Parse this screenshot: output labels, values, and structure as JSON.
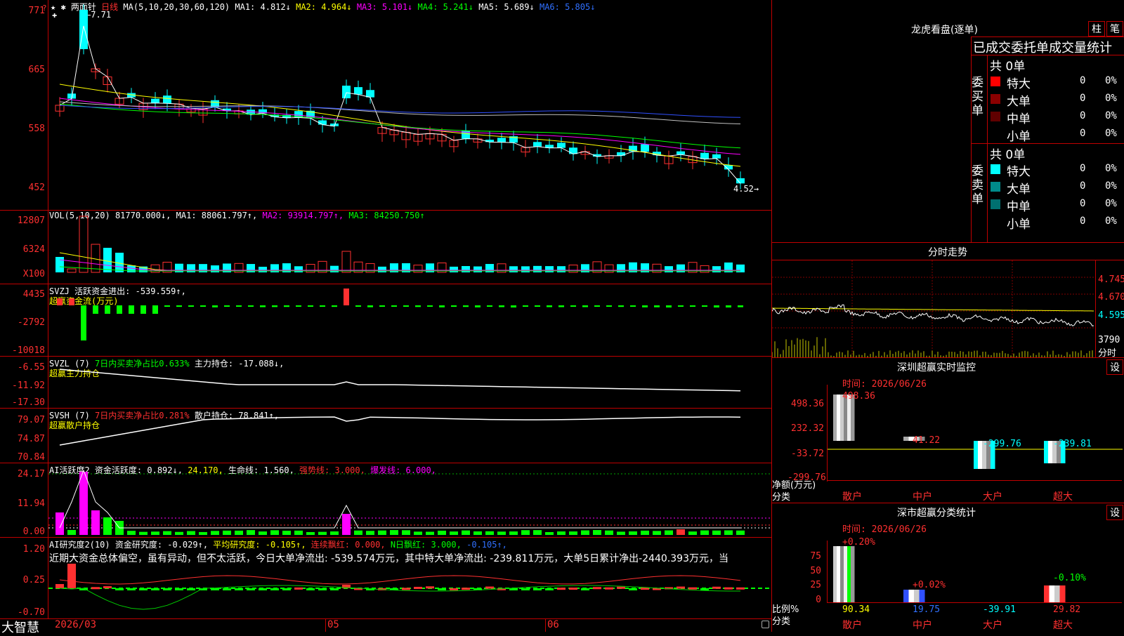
{
  "header": {
    "indicator_marks": "★ ✱",
    "stock_name": "两面针",
    "period": "日线",
    "ma_params": "MA(5,10,20,30,60,120)",
    "ma1": "MA1: 4.812↓",
    "ma2": "MA2: 4.964↓",
    "ma3": "MA3: 5.101↓",
    "ma4": "MA4: 5.241↓",
    "ma5": "MA5: 5.689↓",
    "ma6": "MA6: 5.805↓",
    "high_marker": "7.71",
    "low_marker": "4.52"
  },
  "price_axis": [
    "771",
    "665",
    "558",
    "452"
  ],
  "vol": {
    "title": "VOL(5,10,20)",
    "value": "81770.000↓,",
    "ma1": "MA1: 88061.797↑,",
    "ma2": "MA2: 93914.797↑,",
    "ma3": "MA3: 84250.750↑",
    "axis": [
      "12807",
      "6324",
      "X100"
    ]
  },
  "svzj": {
    "title": "SVZJ",
    "text": "活跃资金进出: -539.559↑,",
    "subtitle": "超赢资金流(万元)",
    "axis": [
      "4435",
      "-2792",
      "-10018"
    ]
  },
  "svzl": {
    "title": "SVZL (7)",
    "ratio": "7日内买卖净占比0.633%",
    "holding": "主力持仓: -17.088↓,",
    "subtitle": "超赢主力持仓",
    "axis": [
      "-6.55",
      "-11.92",
      "-17.30"
    ]
  },
  "svsh": {
    "title": "SVSH (7)",
    "ratio": "7日内买卖净占比0.281%",
    "holding": "散户持仓: 78.841↑,",
    "subtitle": "超赢散户持仓",
    "axis": [
      "79.07",
      "74.87",
      "70.84"
    ]
  },
  "ai1": {
    "title": "AI活跃度2",
    "fund": "资金活跃度: 0.892↓,",
    "v2": "24.170,",
    "life": "生命线: 1.560,",
    "strong": "强势线: 3.000,",
    "burst": "爆发线: 6.000,",
    "axis": [
      "24.17",
      "11.94",
      "0.00"
    ]
  },
  "ai2": {
    "title": "AI研究度2(10)",
    "fund": "资金研究度: -0.029↑,",
    "avg": "平均研究度: -0.105↑,",
    "cont": "连续飘红: 0.000,",
    "nday": "N日飘红: 3.000,",
    "last": "-0.105↑,",
    "comment": "近期大资金总体偏空，虽有异动，但不太活跃，今日大单净流出: -539.574万元，其中特大单净流出: -239.811万元，大单5日累计净出-2440.393万元，当",
    "axis": [
      "1.20",
      "0.25",
      "-0.70"
    ]
  },
  "bottom": {
    "logo": "大智慧",
    "dates": [
      "2026/03",
      "05",
      "06"
    ]
  },
  "right": {
    "lhb_title": "龙虎看盘(逐单)",
    "btn_zhu": "柱",
    "btn_bi": "笔",
    "stat_title": "已成交委托单成交量统计",
    "buy_label": "委买单",
    "sell_label": "委卖单",
    "buy_total": "共 0单",
    "sell_total": "共 0单",
    "buy_rows": [
      {
        "name": "特大",
        "count": "0",
        "pct": "0%",
        "color": "#ff0000"
      },
      {
        "name": "大单",
        "count": "0",
        "pct": "0%",
        "color": "#8b0000"
      },
      {
        "name": "中单",
        "count": "0",
        "pct": "0%",
        "color": "#600000"
      },
      {
        "name": "小单",
        "count": "0",
        "pct": "0%",
        "color": ""
      }
    ],
    "sell_rows": [
      {
        "name": "特大",
        "count": "0",
        "pct": "0%",
        "color": "#00ffff"
      },
      {
        "name": "大单",
        "count": "0",
        "pct": "0%",
        "color": "#008b8b"
      },
      {
        "name": "中单",
        "count": "0",
        "pct": "0%",
        "color": "#007070"
      },
      {
        "name": "小单",
        "count": "0",
        "pct": "0%",
        "color": ""
      }
    ],
    "fenshi_title": "分时走势",
    "fenshi_axis": [
      "4.745",
      "4.670",
      "4.595"
    ],
    "fenshi_vol": "3790",
    "fenshi_label": "分时",
    "sz_monitor_title": "深圳超赢实时监控",
    "btn_set": "设",
    "time1": "时间: 2026/06/26",
    "net_axis": [
      "498.36",
      "232.32",
      "-33.72",
      "-299.76"
    ],
    "net_label": "净额(万元)",
    "cat_label": "分类",
    "categories": [
      "散户",
      "中户",
      "大户",
      "超大"
    ],
    "net_values": [
      "498.36",
      "41.22",
      "-299.76",
      "-239.81"
    ],
    "sz_class_title": "深市超赢分类统计",
    "time2": "时间: 2026/06/26",
    "ratio_axis": [
      "75",
      "50",
      "25",
      "0"
    ],
    "ratio_label": "比例%",
    "ratio_pct": [
      "+0.20%",
      "+0.02%",
      "",
      "-0.10%"
    ],
    "ratio_values": [
      "90.34",
      "19.75",
      "-39.91",
      "29.82"
    ]
  },
  "chart_data": {
    "type": "candlestick",
    "ylim": [
      4.52,
      7.71
    ],
    "close_last": 4.52,
    "ma_last": {
      "MA1": 4.812,
      "MA2": 4.964,
      "MA3": 5.101,
      "MA4": 5.241,
      "MA5": 5.689,
      "MA6": 5.805
    }
  }
}
